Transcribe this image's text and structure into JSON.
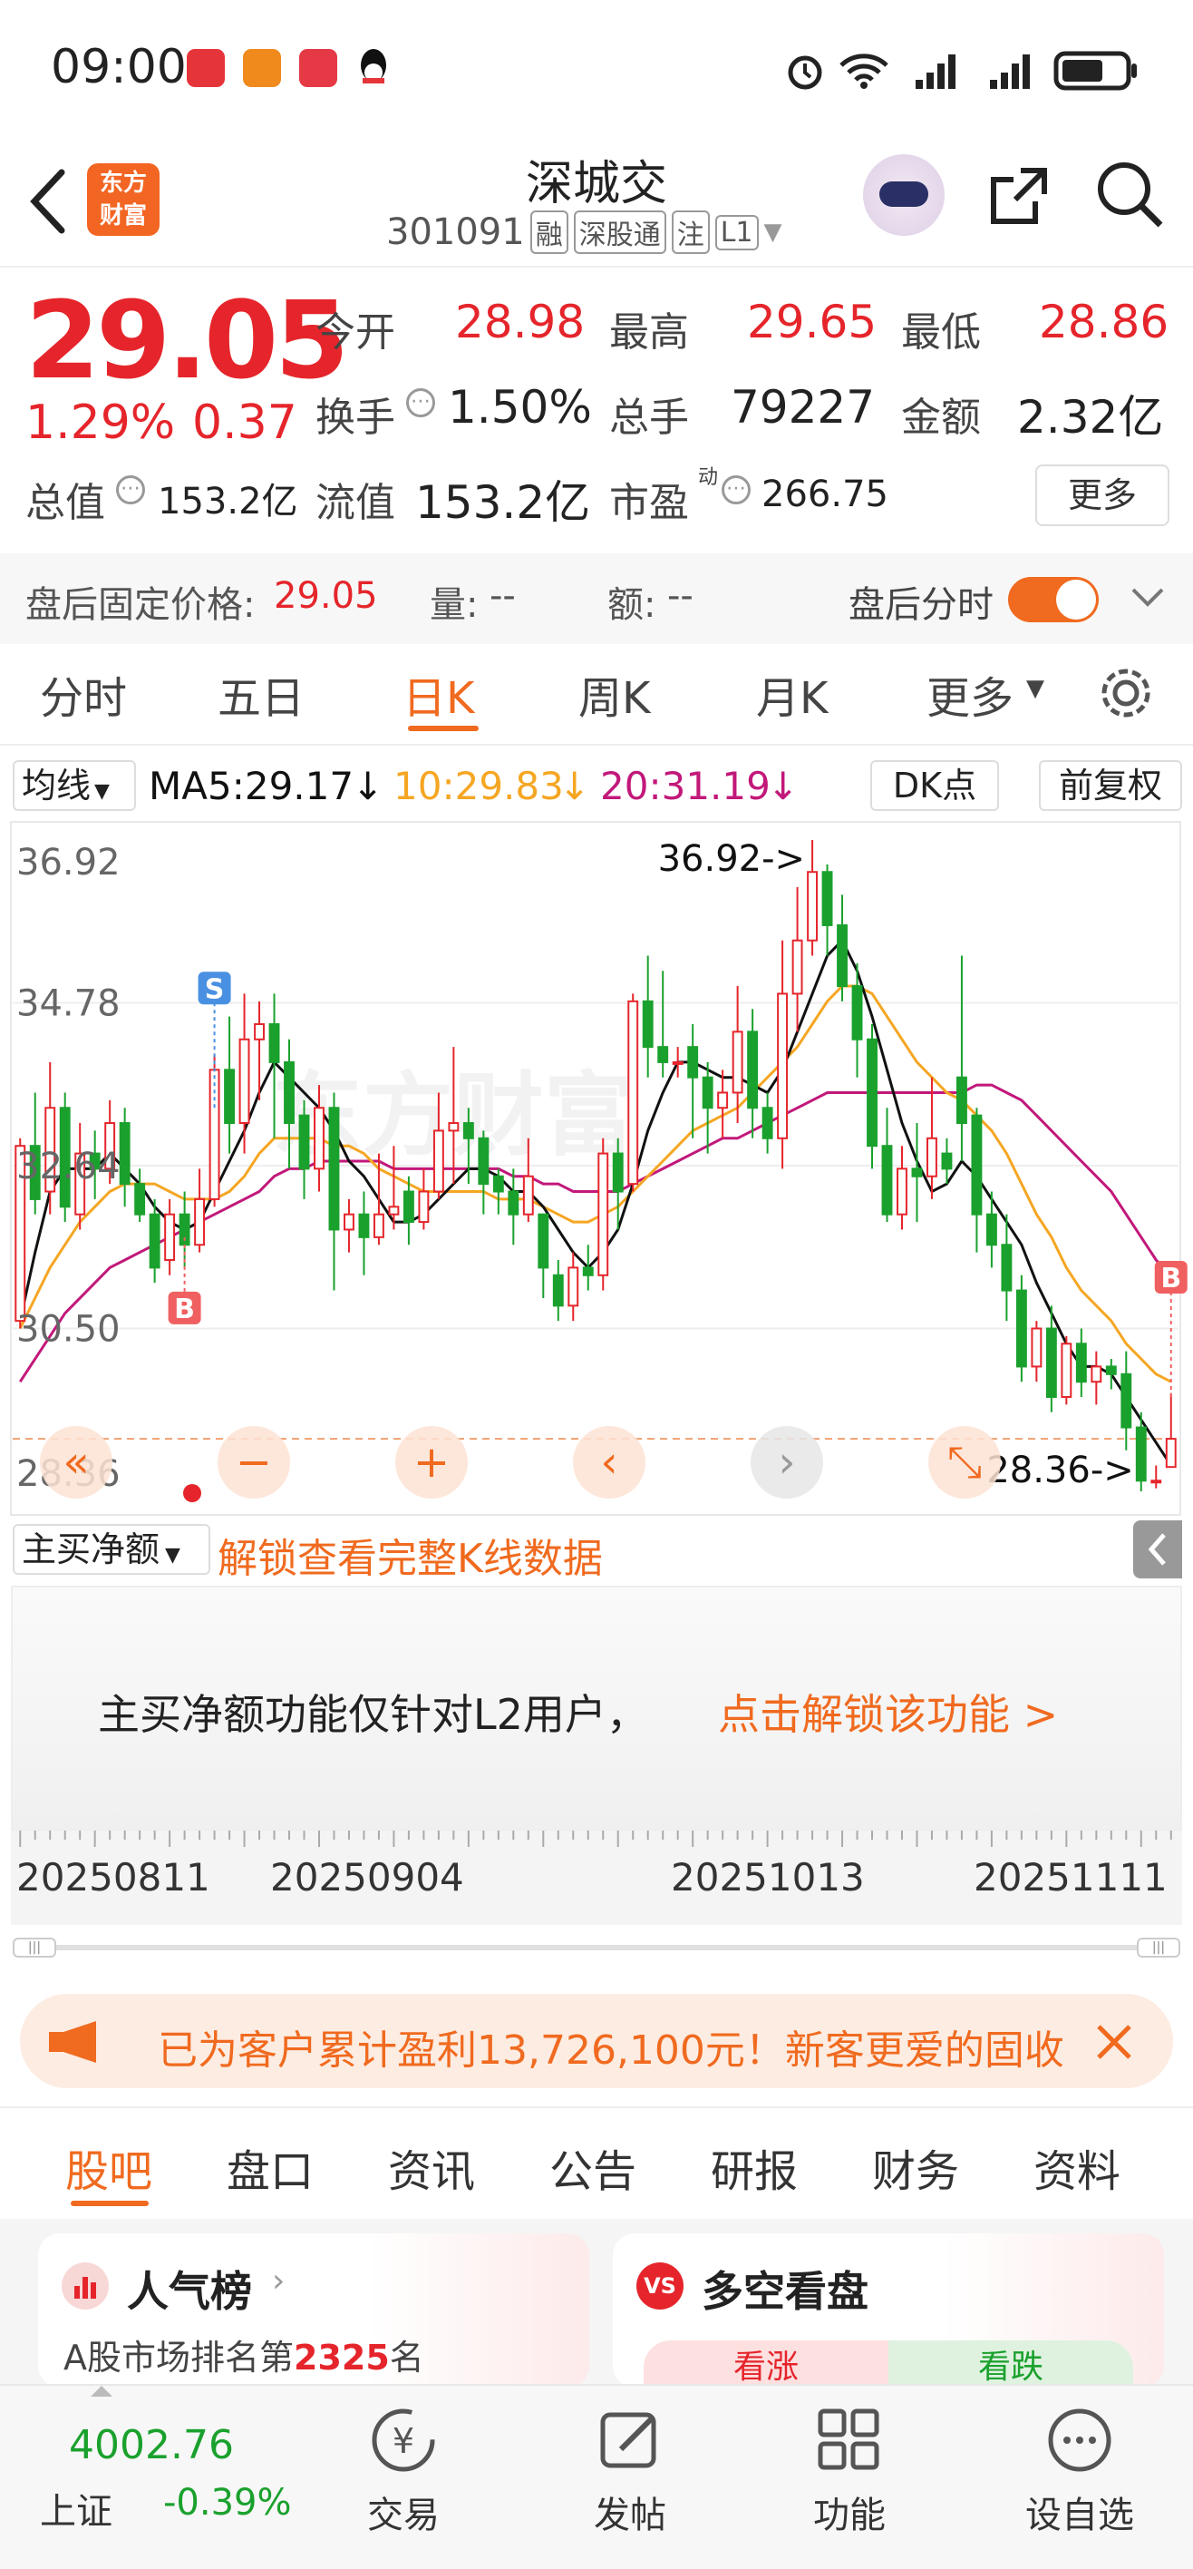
{
  "status_bar": {
    "time": "09:00"
  },
  "header": {
    "title": "深城交",
    "code": "301091",
    "tags": [
      "融",
      "深股通",
      "注",
      "L1"
    ],
    "logo_line1": "东方",
    "logo_line2": "财富"
  },
  "quote": {
    "price": "29.05",
    "change_pct": "1.29%",
    "change": "0.37",
    "open_label": "今开",
    "open": "28.98",
    "high_label": "最高",
    "high": "29.65",
    "low_label": "最低",
    "low": "28.86",
    "turnover_label": "换手",
    "turnover": "1.50%",
    "volume_label": "总手",
    "volume": "79227",
    "amount_label": "金额",
    "amount": "2.32亿",
    "mktcap_label": "总值",
    "mktcap": "153.2亿",
    "float_label": "流值",
    "float_cap": "153.2亿",
    "pe_label": "市盈",
    "pe_sup": "动",
    "pe": "266.75",
    "more_button": "更多"
  },
  "after_hours": {
    "label": "盘后固定价格:",
    "price": "29.05",
    "vol_label": "量:",
    "vol": "--",
    "amt_label": "额:",
    "amt": "--",
    "toggle_label": "盘后分时",
    "toggle_on": true
  },
  "chart_tabs": [
    "分时",
    "五日",
    "日K",
    "周K",
    "月K",
    "更多"
  ],
  "active_chart_tab": "日K",
  "ma_bar": {
    "selector": "均线",
    "ma5": "MA5:29.17",
    "ma10": "10:29.83",
    "ma20": "20:31.19",
    "dk_button": "DK点",
    "adjust_button": "前复权"
  },
  "colors": {
    "up": "#e5252b",
    "down": "#1aa12d",
    "ma5": "#111111",
    "ma10": "#f5a623",
    "ma20": "#c2187a",
    "accent": "#f06a1f"
  },
  "chart_data": {
    "type": "candlestick",
    "y_ticks": [
      "36.92",
      "34.78",
      "32.64",
      "30.50",
      "28.36"
    ],
    "ylim": [
      28.36,
      36.92
    ],
    "high_annotation": "36.92->",
    "low_annotation": "28.36->",
    "signal_buy": "B",
    "signal_sell": "S",
    "x_labels": [
      "20250811",
      "20250904",
      "20251013",
      "20251111"
    ],
    "candles": [
      [
        30.6,
        32.9,
        30.5,
        33.0
      ],
      [
        32.9,
        32.2,
        32.0,
        33.6
      ],
      [
        32.3,
        33.4,
        32.0,
        34.0
      ],
      [
        33.4,
        32.1,
        31.9,
        33.6
      ],
      [
        32.0,
        32.8,
        31.8,
        33.2
      ],
      [
        32.8,
        32.6,
        32.2,
        33.1
      ],
      [
        32.6,
        33.2,
        32.4,
        33.5
      ],
      [
        33.2,
        32.4,
        32.1,
        33.4
      ],
      [
        32.4,
        32.0,
        31.9,
        32.6
      ],
      [
        32.0,
        31.3,
        31.1,
        32.2
      ],
      [
        31.4,
        32.0,
        31.2,
        32.2
      ],
      [
        32.0,
        31.6,
        31.3,
        32.3
      ],
      [
        31.6,
        32.2,
        31.5,
        32.6
      ],
      [
        32.2,
        33.9,
        32.1,
        34.1
      ],
      [
        33.9,
        33.2,
        32.8,
        34.6
      ],
      [
        33.2,
        34.3,
        32.8,
        34.9
      ],
      [
        34.3,
        34.5,
        33.5,
        34.8
      ],
      [
        34.5,
        34.0,
        33.0,
        34.9
      ],
      [
        34.0,
        33.2,
        32.6,
        34.3
      ],
      [
        33.3,
        32.6,
        32.2,
        33.5
      ],
      [
        32.6,
        33.4,
        32.3,
        33.7
      ],
      [
        33.4,
        31.8,
        31.0,
        33.6
      ],
      [
        31.8,
        32.0,
        31.5,
        32.2
      ],
      [
        32.0,
        31.7,
        31.2,
        32.3
      ],
      [
        31.7,
        32.0,
        31.6,
        32.8
      ],
      [
        32.0,
        32.1,
        31.8,
        32.9
      ],
      [
        32.3,
        31.9,
        31.6,
        32.5
      ],
      [
        31.9,
        32.3,
        31.8,
        32.6
      ],
      [
        32.3,
        33.1,
        32.2,
        33.6
      ],
      [
        33.1,
        33.2,
        32.4,
        34.2
      ],
      [
        33.2,
        33.0,
        32.4,
        33.4
      ],
      [
        33.0,
        32.4,
        32.0,
        33.1
      ],
      [
        32.5,
        32.3,
        32.0,
        32.6
      ],
      [
        32.3,
        32.0,
        31.6,
        32.6
      ],
      [
        32.0,
        32.5,
        31.9,
        33.0
      ],
      [
        32.0,
        31.3,
        30.9,
        32.0
      ],
      [
        31.2,
        30.8,
        30.6,
        31.4
      ],
      [
        30.8,
        31.3,
        30.6,
        31.5
      ],
      [
        31.3,
        31.2,
        31.0,
        31.6
      ],
      [
        31.2,
        32.8,
        31.0,
        33.0
      ],
      [
        32.8,
        32.3,
        31.8,
        33.0
      ],
      [
        32.4,
        34.8,
        32.3,
        34.9
      ],
      [
        34.8,
        34.2,
        33.8,
        35.4
      ],
      [
        34.2,
        34.0,
        33.8,
        35.2
      ],
      [
        34.0,
        34.0,
        33.8,
        34.2
      ],
      [
        34.2,
        33.8,
        33.0,
        34.5
      ],
      [
        33.8,
        33.4,
        32.8,
        34.0
      ],
      [
        33.4,
        33.6,
        33.0,
        33.9
      ],
      [
        33.6,
        34.4,
        33.2,
        35.0
      ],
      [
        34.4,
        33.4,
        33.0,
        34.7
      ],
      [
        33.4,
        33.0,
        32.8,
        33.6
      ],
      [
        33.0,
        34.9,
        32.6,
        35.6
      ],
      [
        34.9,
        35.6,
        34.4,
        36.3
      ],
      [
        35.6,
        36.5,
        35.4,
        36.92
      ],
      [
        36.5,
        35.8,
        35.4,
        36.6
      ],
      [
        35.8,
        35.0,
        34.8,
        36.2
      ],
      [
        35.0,
        34.3,
        33.8,
        35.3
      ],
      [
        34.3,
        32.9,
        32.6,
        34.5
      ],
      [
        32.9,
        32.0,
        31.9,
        33.4
      ],
      [
        32.0,
        32.6,
        31.8,
        32.9
      ],
      [
        32.6,
        32.5,
        31.9,
        33.2
      ],
      [
        32.5,
        33.0,
        32.2,
        33.8
      ],
      [
        32.8,
        32.6,
        32.4,
        33.0
      ],
      [
        33.8,
        33.2,
        32.7,
        35.4
      ],
      [
        33.3,
        32.0,
        31.5,
        33.4
      ],
      [
        32.0,
        31.6,
        31.3,
        32.3
      ],
      [
        31.6,
        31.0,
        30.6,
        32.0
      ],
      [
        31.0,
        30.0,
        29.8,
        31.2
      ],
      [
        30.0,
        30.5,
        29.8,
        30.6
      ],
      [
        30.5,
        29.6,
        29.4,
        30.8
      ],
      [
        29.6,
        30.3,
        29.5,
        30.4
      ],
      [
        30.3,
        29.8,
        29.6,
        30.5
      ],
      [
        29.8,
        30.0,
        29.5,
        30.2
      ],
      [
        30.0,
        29.9,
        29.7,
        30.1
      ],
      [
        29.9,
        29.2,
        28.9,
        30.2
      ],
      [
        29.2,
        28.5,
        28.36,
        29.4
      ],
      [
        28.5,
        28.5,
        28.4,
        28.7
      ],
      [
        28.68,
        29.05,
        28.86,
        29.65
      ]
    ],
    "ma5": [
      30.6,
      31.5,
      32.3,
      32.6,
      32.6,
      32.6,
      32.8,
      32.6,
      32.4,
      32.1,
      31.9,
      31.8,
      31.9,
      32.3,
      32.7,
      33.1,
      33.6,
      34.0,
      33.8,
      33.6,
      33.4,
      33.1,
      32.7,
      32.5,
      32.2,
      31.9,
      31.9,
      32.0,
      32.2,
      32.4,
      32.6,
      32.6,
      32.5,
      32.3,
      32.3,
      32.1,
      31.8,
      31.5,
      31.3,
      31.5,
      31.8,
      32.4,
      33.1,
      33.6,
      34.0,
      34.0,
      33.9,
      33.8,
      33.8,
      33.7,
      33.6,
      33.9,
      34.4,
      34.9,
      35.4,
      35.6,
      35.2,
      34.6,
      33.9,
      33.2,
      32.7,
      32.3,
      32.4,
      32.7,
      32.5,
      32.2,
      31.9,
      31.6,
      31.1,
      30.7,
      30.3,
      30.0,
      30.0,
      29.9,
      29.6,
      29.3,
      29.0,
      28.7
    ],
    "ma10": [
      30.5,
      30.9,
      31.3,
      31.6,
      31.9,
      32.1,
      32.3,
      32.4,
      32.4,
      32.4,
      32.3,
      32.2,
      32.2,
      32.2,
      32.3,
      32.5,
      32.8,
      33.0,
      33.0,
      33.0,
      33.0,
      32.9,
      32.9,
      32.8,
      32.6,
      32.5,
      32.4,
      32.3,
      32.3,
      32.3,
      32.3,
      32.3,
      32.2,
      32.2,
      32.2,
      32.1,
      32.0,
      31.9,
      31.9,
      32.0,
      32.1,
      32.3,
      32.5,
      32.7,
      32.9,
      33.1,
      33.2,
      33.3,
      33.4,
      33.6,
      33.8,
      34.0,
      34.2,
      34.5,
      34.8,
      35.0,
      35.0,
      34.9,
      34.6,
      34.3,
      34.0,
      33.8,
      33.6,
      33.5,
      33.3,
      33.1,
      32.8,
      32.4,
      32.0,
      31.7,
      31.3,
      31.0,
      30.8,
      30.6,
      30.3,
      30.1,
      29.9,
      29.8
    ],
    "ma20": [
      29.8,
      30.1,
      30.4,
      30.7,
      30.9,
      31.1,
      31.3,
      31.4,
      31.5,
      31.6,
      31.7,
      31.8,
      31.9,
      32.0,
      32.1,
      32.2,
      32.3,
      32.5,
      32.6,
      32.6,
      32.7,
      32.7,
      32.7,
      32.7,
      32.7,
      32.6,
      32.6,
      32.6,
      32.6,
      32.6,
      32.6,
      32.6,
      32.6,
      32.5,
      32.5,
      32.4,
      32.4,
      32.3,
      32.3,
      32.3,
      32.3,
      32.4,
      32.5,
      32.6,
      32.7,
      32.8,
      32.9,
      33.0,
      33.0,
      33.1,
      33.2,
      33.3,
      33.4,
      33.5,
      33.6,
      33.6,
      33.6,
      33.6,
      33.6,
      33.6,
      33.6,
      33.6,
      33.6,
      33.6,
      33.7,
      33.7,
      33.6,
      33.5,
      33.3,
      33.1,
      32.9,
      32.7,
      32.5,
      32.3,
      32.0,
      31.7,
      31.4,
      31.2
    ]
  },
  "indicator": {
    "selector": "主买净额",
    "unlock_link": "解锁查看完整K线数据",
    "lock_message": "主买净额功能仅针对L2用户，",
    "lock_cta": "点击解锁该功能 >"
  },
  "promo": {
    "text": "已为客户累计盈利13,726,100元！新客更爱的固收"
  },
  "news_tabs": [
    "股吧",
    "盘口",
    "资讯",
    "公告",
    "研报",
    "财务",
    "资料"
  ],
  "active_news_tab": "股吧",
  "cards": {
    "popularity_title": "人气榜",
    "popularity_prefix": "A股市场排名第",
    "popularity_rank": "2325",
    "popularity_suffix": "名",
    "vs_title": "多空看盘",
    "vs_up": "看涨",
    "vs_down": "看跌"
  },
  "bottom_nav": {
    "index_value": "4002.76",
    "index_name": "上证",
    "index_change": "-0.39%",
    "items": [
      "交易",
      "发帖",
      "功能",
      "设自选"
    ]
  }
}
